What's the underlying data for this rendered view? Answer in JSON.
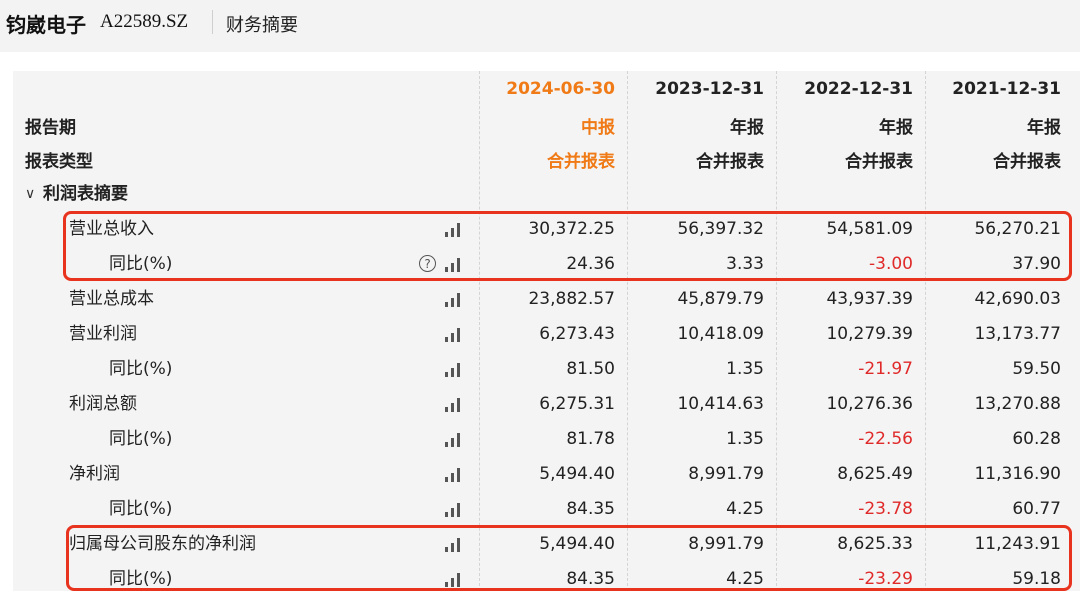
{
  "header": {
    "company": "钧崴电子",
    "code": "A22589.SZ",
    "section": "财务摘要"
  },
  "table": {
    "labels": {
      "period": "报告期",
      "type": "报表类型"
    },
    "columns": [
      {
        "date": "2024-06-30",
        "period": "中报",
        "type": "合并报表",
        "current": true
      },
      {
        "date": "2023-12-31",
        "period": "年报",
        "type": "合并报表",
        "current": false
      },
      {
        "date": "2022-12-31",
        "period": "年报",
        "type": "合并报表",
        "current": false
      },
      {
        "date": "2021-12-31",
        "period": "年报",
        "type": "合并报表",
        "current": false
      }
    ],
    "section_title": "利润表摘要",
    "rows": [
      {
        "name": "营业总收入",
        "indent": 1,
        "help": false,
        "values": [
          "30,372.25",
          "56,397.32",
          "54,581.09",
          "56,270.21"
        ]
      },
      {
        "name": "同比(%)",
        "indent": 2,
        "help": true,
        "values": [
          "24.36",
          "3.33",
          "-3.00",
          "37.90"
        ]
      },
      {
        "name": "营业总成本",
        "indent": 1,
        "help": false,
        "values": [
          "23,882.57",
          "45,879.79",
          "43,937.39",
          "42,690.03"
        ]
      },
      {
        "name": "营业利润",
        "indent": 1,
        "help": false,
        "values": [
          "6,273.43",
          "10,418.09",
          "10,279.39",
          "13,173.77"
        ]
      },
      {
        "name": "同比(%)",
        "indent": 2,
        "help": false,
        "values": [
          "81.50",
          "1.35",
          "-21.97",
          "59.50"
        ]
      },
      {
        "name": "利润总额",
        "indent": 1,
        "help": false,
        "values": [
          "6,275.31",
          "10,414.63",
          "10,276.36",
          "13,270.88"
        ]
      },
      {
        "name": "同比(%)",
        "indent": 2,
        "help": false,
        "values": [
          "81.78",
          "1.35",
          "-22.56",
          "60.28"
        ]
      },
      {
        "name": "净利润",
        "indent": 1,
        "help": false,
        "values": [
          "5,494.40",
          "8,991.79",
          "8,625.49",
          "11,316.90"
        ]
      },
      {
        "name": "同比(%)",
        "indent": 2,
        "help": false,
        "values": [
          "84.35",
          "4.25",
          "-23.78",
          "60.77"
        ]
      },
      {
        "name": "归属母公司股东的净利润",
        "indent": 1,
        "help": false,
        "values": [
          "5,494.40",
          "8,991.79",
          "8,625.33",
          "11,243.91"
        ]
      },
      {
        "name": "同比(%)",
        "indent": 2,
        "help": false,
        "values": [
          "84.35",
          "4.25",
          "-23.29",
          "59.18"
        ]
      }
    ]
  },
  "colors": {
    "accent": "#f07a16",
    "negative": "#e02a2a",
    "highlight": "#e8331f"
  },
  "icons": {
    "chart": "bar-chart-icon",
    "help": "question-circle-icon",
    "collapse": "chevron-down-icon"
  }
}
